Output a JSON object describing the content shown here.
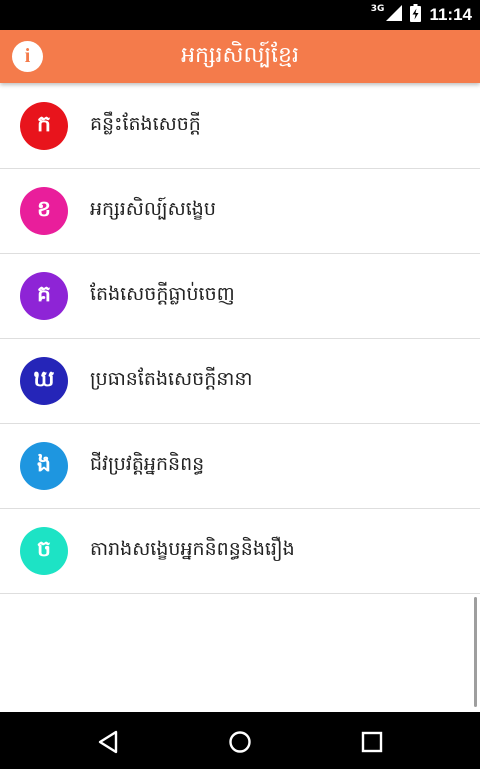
{
  "status_bar": {
    "network": "3G",
    "time": "11:14"
  },
  "app_bar": {
    "title": "អក្សរសិល្ប៍ខ្មែរ",
    "info_glyph": "i"
  },
  "menu": {
    "items": [
      {
        "icon_char": "ក",
        "icon_color": "#e8141c",
        "label": "គន្លឹះតែងសេចក្ដី"
      },
      {
        "icon_char": "ខ",
        "icon_color": "#e91e9b",
        "label": "អក្សរសិល្ប៍សង្ខេប"
      },
      {
        "icon_char": "គ",
        "icon_color": "#8e24d6",
        "label": "តែងសេចក្ដីធ្លាប់ចេញ"
      },
      {
        "icon_char": "ឃ",
        "icon_color": "#2525b8",
        "label": "ប្រធានតែងសេចក្ដីនានា"
      },
      {
        "icon_char": "ង",
        "icon_color": "#1e96e0",
        "label": "ជីវប្រវត្តិអ្នកនិពន្ធ"
      },
      {
        "icon_char": "ច",
        "icon_color": "#1de3c5",
        "label": "តារាងសង្ខេបអ្នកនិពន្ធនិងរឿង"
      }
    ]
  },
  "colors": {
    "accent": "#f47b4b",
    "divider": "#dedede"
  }
}
